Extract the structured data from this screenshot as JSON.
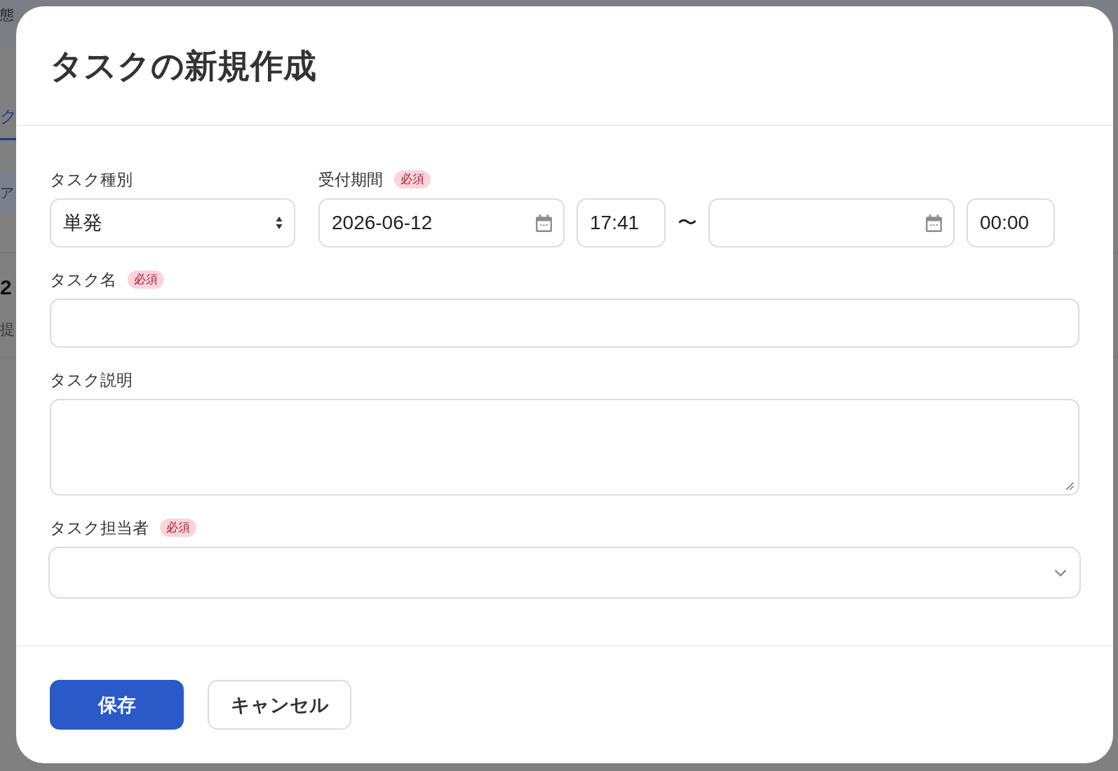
{
  "background_page": {
    "header_text": "態",
    "tab": {
      "label": "ク",
      "selected": true
    },
    "notice": "ア",
    "heading": "2",
    "caption": "提"
  },
  "dialog": {
    "title": "タスクの新規作成",
    "rows": [
      [
        {
          "kind": "select",
          "label": "タスク種別",
          "value": "単発"
        },
        {
          "kind": "period",
          "label": "受付期間",
          "required_label": "必須",
          "start_date": "2026-06-12",
          "start_time": "17:41",
          "separator": "〜",
          "end_time": "00:00"
        }
      ],
      [
        {
          "kind": "text",
          "label": "タスク名",
          "required_label": "必須"
        }
      ],
      [
        {
          "kind": "textarea",
          "label": "タスク説明"
        }
      ],
      [
        {
          "kind": "dropdown",
          "label": "タスク担当者",
          "required_label": "必須"
        }
      ]
    ],
    "buttons": [
      {
        "kind": "save",
        "label": "保存"
      },
      {
        "kind": "cancel",
        "label": "キャンセル"
      }
    ]
  }
}
